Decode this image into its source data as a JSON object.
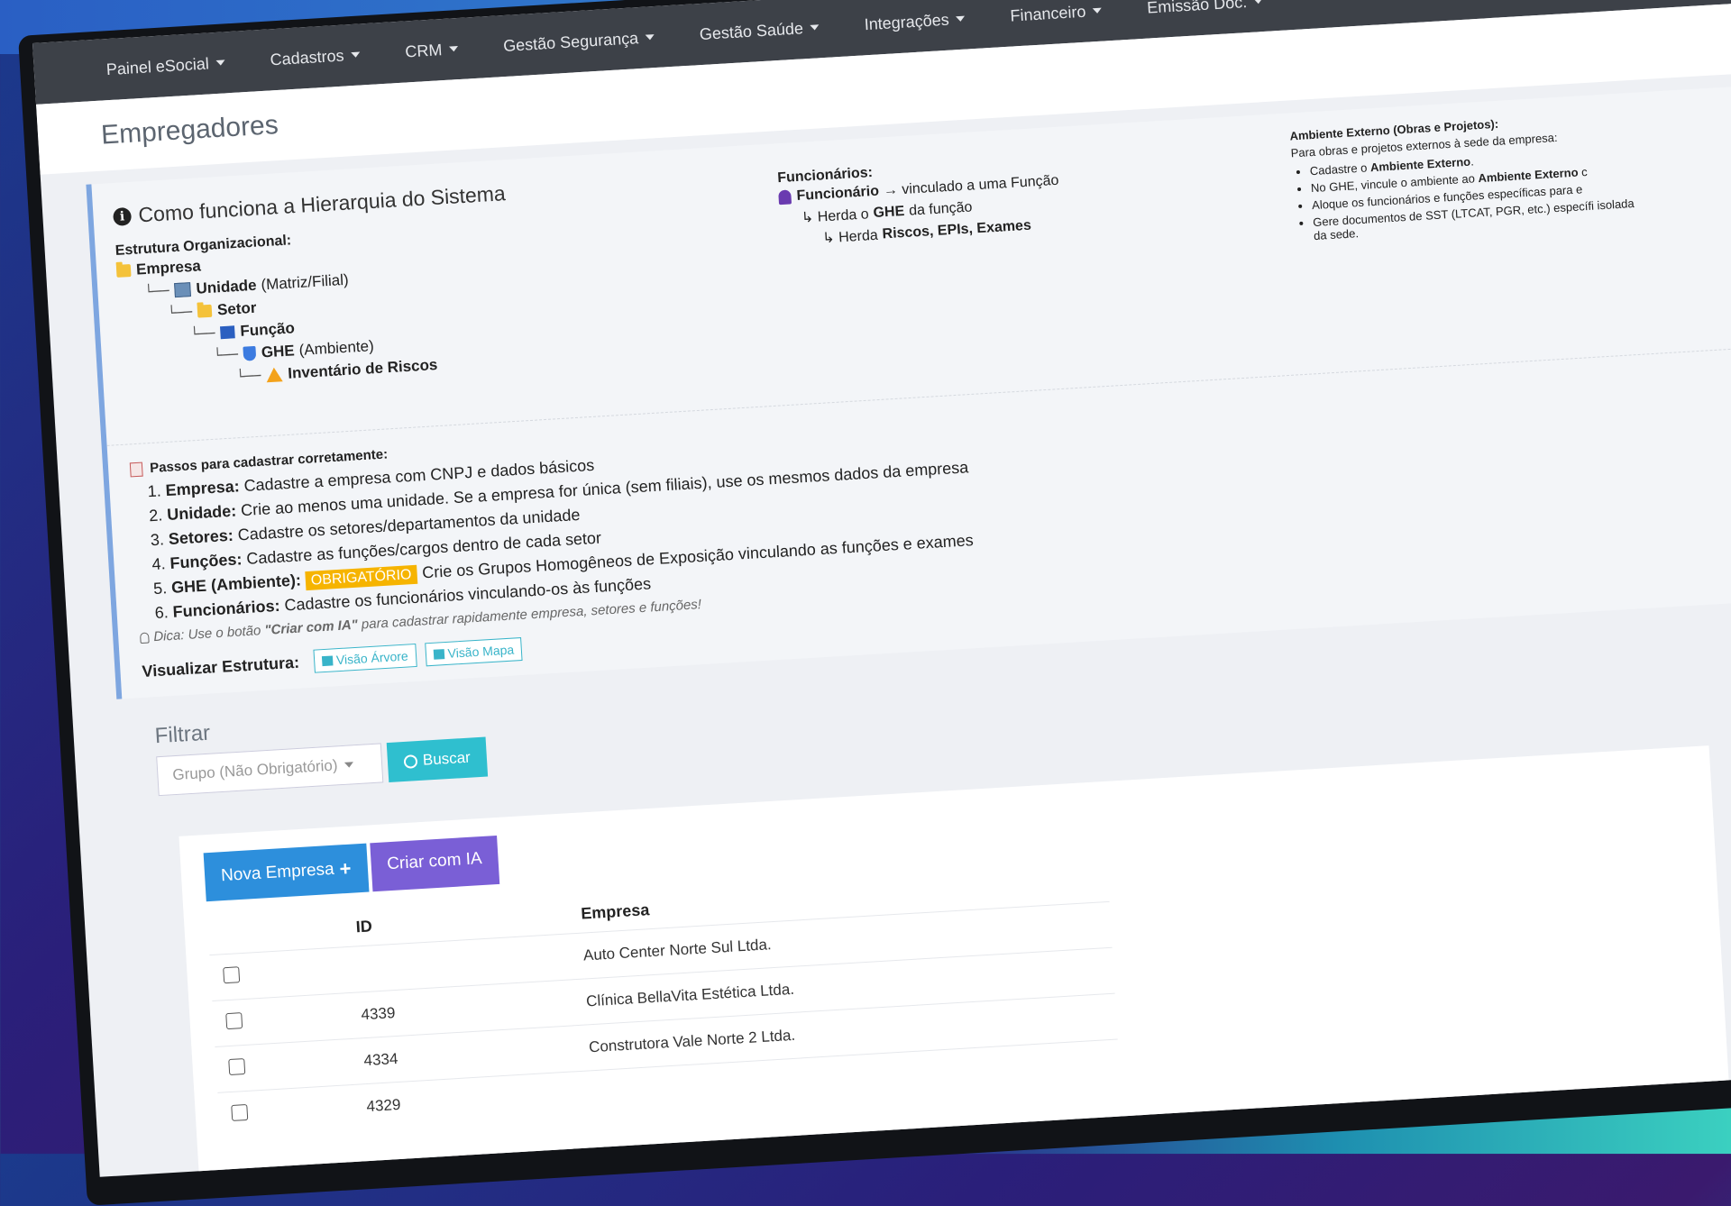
{
  "navbar": {
    "items": [
      {
        "label": "Painel eSocial"
      },
      {
        "label": "Cadastros"
      },
      {
        "label": "CRM"
      },
      {
        "label": "Gestão Segurança"
      },
      {
        "label": "Gestão Saúde"
      },
      {
        "label": "Integrações"
      },
      {
        "label": "Financeiro"
      },
      {
        "label": "Emissão Doc."
      }
    ]
  },
  "page": {
    "title": "Empregadores"
  },
  "info": {
    "title": "Como funciona a Hierarquia do Sistema",
    "org_label": "Estrutura Organizacional:",
    "tree": [
      {
        "name": "Empresa",
        "suffix": ""
      },
      {
        "name": "Unidade",
        "suffix": "(Matriz/Filial)"
      },
      {
        "name": "Setor",
        "suffix": ""
      },
      {
        "name": "Função",
        "suffix": ""
      },
      {
        "name": "GHE",
        "suffix": "(Ambiente)"
      },
      {
        "name": "Inventário de Riscos",
        "suffix": ""
      }
    ],
    "employees": {
      "label": "Funcionários:",
      "line1_bold": "Funcionário",
      "line1_rest": "→ vinculado a uma Função",
      "line2_pre": "↳ Herda o",
      "line2_bold": "GHE",
      "line2_post": "da função",
      "line3_pre": "↳ Herda",
      "line3_bold": "Riscos, EPIs, Exames"
    },
    "external": {
      "title": "Ambiente Externo (Obras e Projetos):",
      "intro": "Para obras e projetos externos à sede da empresa:",
      "items": [
        {
          "pre": "Cadastre o",
          "bold": "Ambiente Externo",
          "post": "."
        },
        {
          "pre": "No GHE, vincule o ambiente ao",
          "bold": "Ambiente Externo",
          "post": "c"
        },
        {
          "pre": "Aloque os funcionários e funções específicas para e",
          "bold": "",
          "post": ""
        },
        {
          "pre": "Gere documentos de SST (LTCAT, PGR, etc.) específi isolada da sede.",
          "bold": "",
          "post": ""
        }
      ]
    },
    "steps": {
      "title": "Passos para cadastrar corretamente:",
      "items": [
        {
          "bold": "Empresa:",
          "text": "Cadastre a empresa com CNPJ e dados básicos"
        },
        {
          "bold": "Unidade:",
          "text": "Crie ao menos uma unidade. Se a empresa for única (sem filiais), use os mesmos dados da empresa"
        },
        {
          "bold": "Setores:",
          "text": "Cadastre os setores/departamentos da unidade"
        },
        {
          "bold": "Funções:",
          "text": "Cadastre as funções/cargos dentro de cada setor"
        },
        {
          "bold": "GHE (Ambiente):",
          "badge": "OBRIGATÓRIO",
          "text": "Crie os Grupos Homogêneos de Exposição vinculando as funções e exames"
        },
        {
          "bold": "Funcionários:",
          "text": "Cadastre os funcionários vinculando-os às funções"
        }
      ]
    },
    "tip": {
      "pre": "Dica: Use o botão",
      "bold": "\"Criar com IA\"",
      "post": "para cadastrar rapidamente empresa, setores e funções!"
    },
    "visualize": {
      "label": "Visualizar Estrutura:",
      "tree_btn": "Visão Árvore",
      "map_btn": "Visão Mapa"
    }
  },
  "filter": {
    "title": "Filtrar",
    "select_placeholder": "Grupo (Não Obrigatório)",
    "search_btn": "Buscar"
  },
  "actions": {
    "new_company": "Nova Empresa",
    "create_ai": "Criar com IA"
  },
  "table": {
    "headers": {
      "id": "ID",
      "company": "Empresa"
    },
    "rows": [
      {
        "id": "",
        "company": "Auto Center Norte Sul Ltda."
      },
      {
        "id": "4339",
        "company": "Clínica BellaVita Estética Ltda."
      },
      {
        "id": "4334",
        "company": "Construtora Vale Norte 2 Ltda."
      },
      {
        "id": "4329",
        "company": ""
      }
    ]
  },
  "colors": {
    "navbar": "#3d4148",
    "accent": "#2fbfcf",
    "primary": "#2d8fdc",
    "ia": "#7a5fd6",
    "badge": "#f6b400"
  }
}
